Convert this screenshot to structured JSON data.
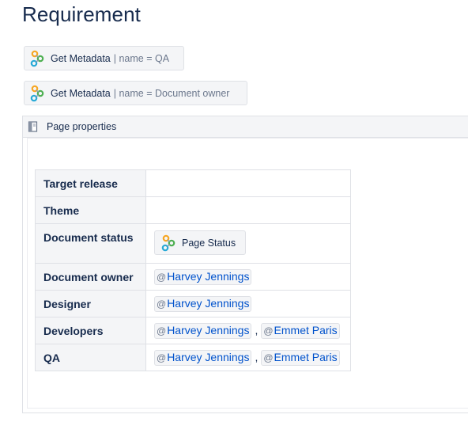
{
  "page": {
    "title": "Requirement"
  },
  "macros": [
    {
      "name": "Get Metadata",
      "params": "| name = QA",
      "icon": "metadata-plugin-icon"
    },
    {
      "name": "Get Metadata",
      "params": "| name = Document owner",
      "icon": "metadata-plugin-icon"
    }
  ],
  "page_properties": {
    "header_label": "Page properties",
    "header_icon": "book-icon",
    "rows": [
      {
        "key": "Target release",
        "values": []
      },
      {
        "key": "Theme",
        "values": []
      },
      {
        "key": "Document status",
        "macro_label": "Page Status"
      },
      {
        "key": "Document owner",
        "values": [
          "Harvey Jennings"
        ]
      },
      {
        "key": "Designer",
        "values": [
          "Harvey Jennings"
        ]
      },
      {
        "key": "Developers",
        "values": [
          "Harvey Jennings",
          "Emmet Paris"
        ]
      },
      {
        "key": "QA",
        "values": [
          "Harvey Jennings",
          "Emmet Paris"
        ]
      }
    ],
    "mention_prefix": "@",
    "separator": ","
  },
  "colors": {
    "text": "#172b4d",
    "link": "#0052cc",
    "macro_bg": "#f4f5f7",
    "border": "#dfe1e6",
    "icon_orange": "#f6a623",
    "icon_green": "#4caf50",
    "icon_teal": "#26a9d6"
  }
}
